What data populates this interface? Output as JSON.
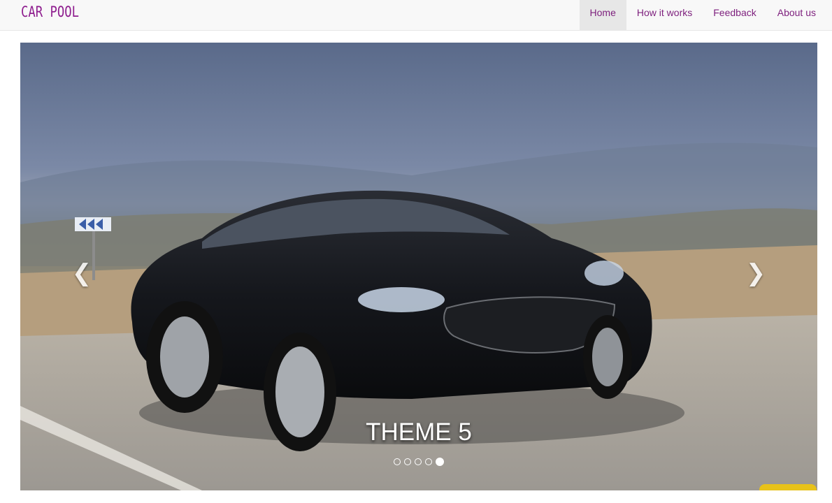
{
  "brand": "CAR POOL",
  "nav": [
    {
      "label": "Home",
      "active": true
    },
    {
      "label": "How it works",
      "active": false
    },
    {
      "label": "Feedback",
      "active": false
    },
    {
      "label": "About us",
      "active": false
    }
  ],
  "carousel": {
    "caption": "THEME 5",
    "prev_label": "Previous",
    "next_label": "Next",
    "slide_count": 5,
    "active_slide": 5
  },
  "colors": {
    "brand": "#8e1d8e",
    "nav_link": "#7d1f7d",
    "navbar_bg": "#f8f8f8"
  }
}
